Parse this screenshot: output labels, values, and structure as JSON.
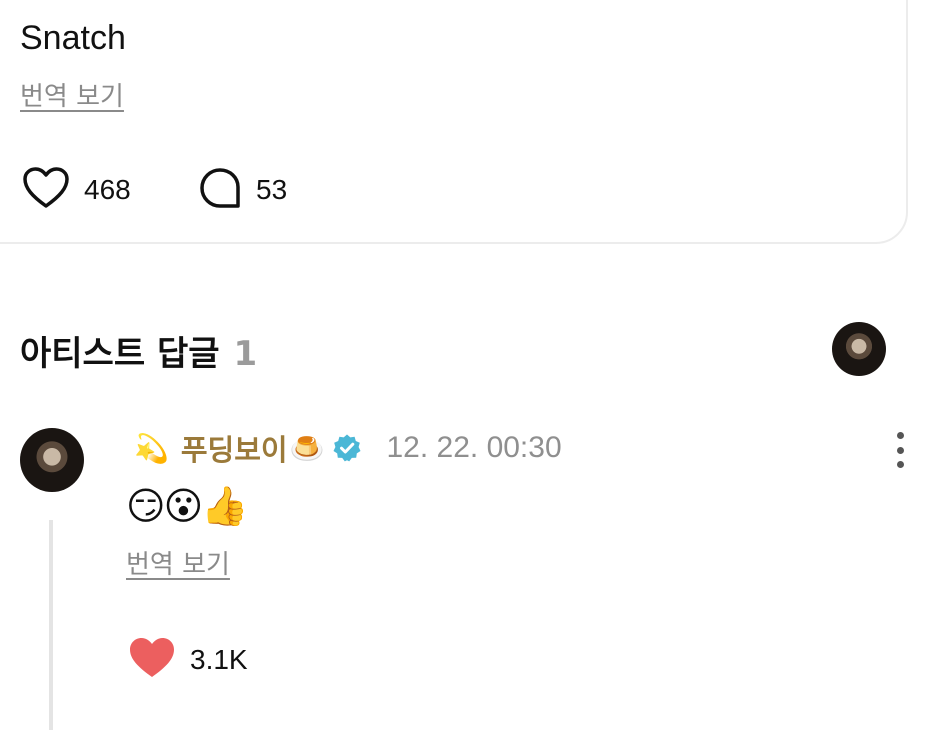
{
  "post": {
    "text": "Snatch",
    "translate_label": "번역 보기",
    "likes": "468",
    "comments": "53"
  },
  "artist_replies": {
    "title": "아티스트 답글",
    "count": "1"
  },
  "comment": {
    "prefix_emoji": "💫",
    "author": "푸딩보이",
    "suffix_emoji": "🍮",
    "timestamp": "12. 22. 00:30",
    "content": "😏😮👍",
    "translate_label": "번역 보기",
    "likes": "3.1K"
  },
  "colors": {
    "author": "#9b7a3a",
    "verified": "#4bb7d6",
    "heart_filled": "#ec5f5f",
    "muted": "#8f8f8f"
  },
  "icons": [
    "heart-outline-icon",
    "comment-bubble-icon",
    "verified-badge-icon",
    "more-vertical-icon",
    "heart-filled-icon"
  ]
}
